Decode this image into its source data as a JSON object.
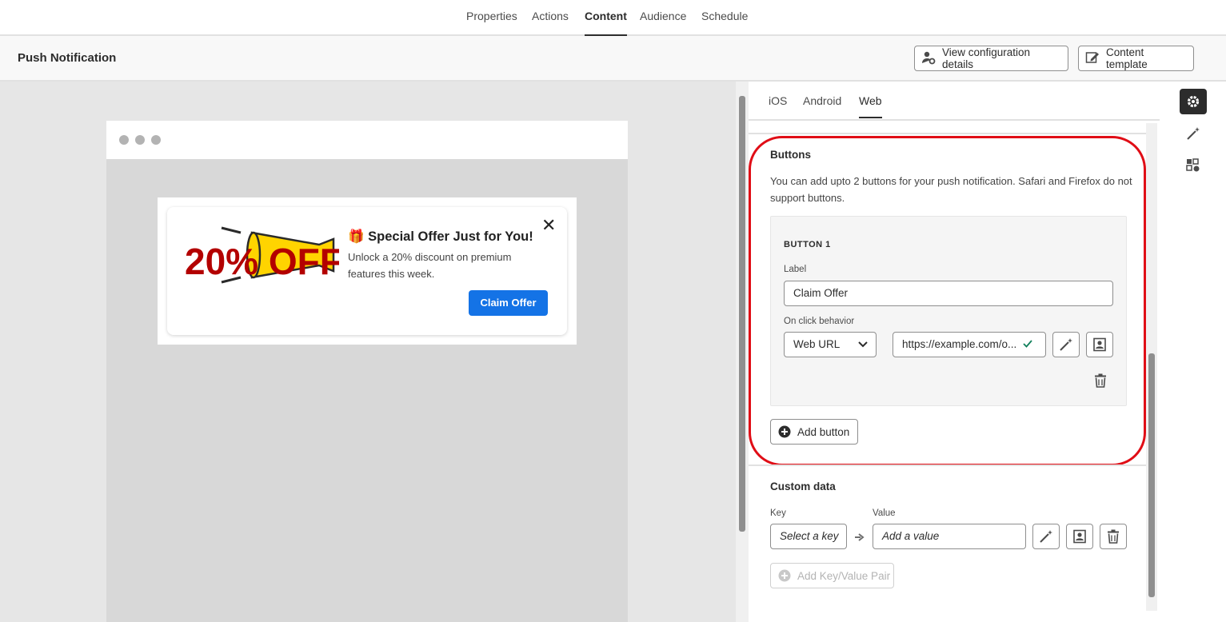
{
  "topnav": {
    "tabs": [
      {
        "label": "Properties"
      },
      {
        "label": "Actions"
      },
      {
        "label": "Content"
      },
      {
        "label": "Audience"
      },
      {
        "label": "Schedule"
      }
    ],
    "active": "Content"
  },
  "header": {
    "title": "Push Notification",
    "view_config_label": "View configuration details",
    "content_template_label": "Content template"
  },
  "preview": {
    "promo_text": "20% OFF",
    "notification_title": "🎁 Special Offer Just for You!",
    "notification_body": "Unlock a 20% discount on premium features this week.",
    "close_glyph": "✕",
    "cta_label": "Claim Offer"
  },
  "platform_tabs": {
    "items": [
      {
        "label": "iOS"
      },
      {
        "label": "Android"
      },
      {
        "label": "Web"
      }
    ],
    "active": "Web"
  },
  "buttons_section": {
    "title": "Buttons",
    "description": "You can add upto 2 buttons for your push notification. Safari and Firefox do not support buttons.",
    "button1": {
      "heading": "BUTTON 1",
      "label_caption": "Label",
      "label_value": "Claim Offer",
      "click_caption": "On click behavior",
      "behavior_value": "Web URL",
      "url_value": "https://example.com/o..."
    },
    "add_button_label": "Add button"
  },
  "custom_data": {
    "title": "Custom data",
    "key_caption": "Key",
    "value_caption": "Value",
    "key_placeholder": "Select a key",
    "value_placeholder": "Add a value",
    "add_pair_label": "Add Key/Value Pair"
  },
  "colors": {
    "accent_blue": "#1473e6",
    "highlight_red": "#e00d16",
    "valid_green": "#12805c"
  }
}
